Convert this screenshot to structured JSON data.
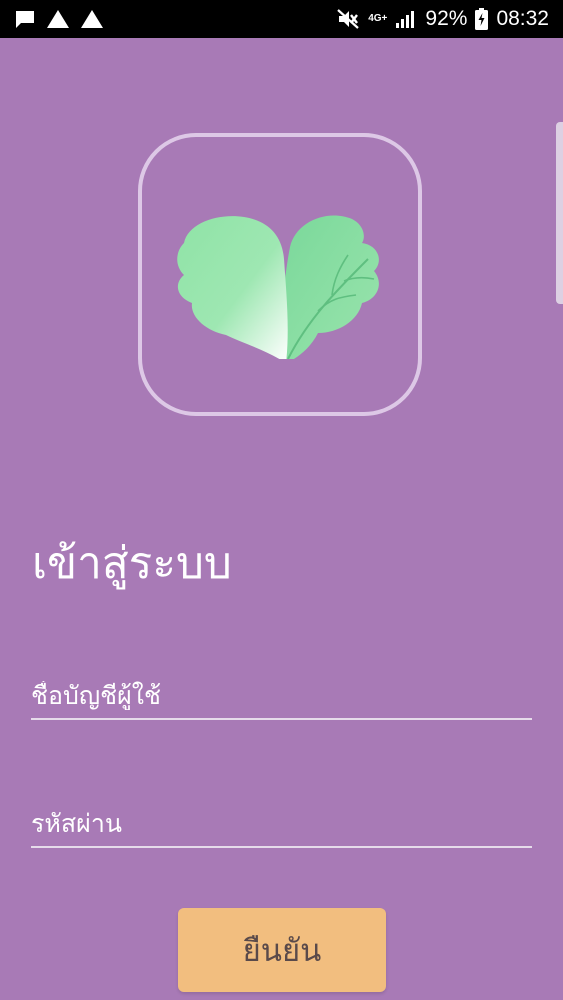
{
  "status_bar": {
    "network_type": "4G+",
    "battery_percent": "92%",
    "time": "08:32",
    "icons": {
      "message": "message-icon",
      "alert1": "warning-triangle-icon",
      "alert2": "warning-triangle-icon",
      "mute": "mute-icon",
      "signal": "signal-strength-icon",
      "battery": "battery-charging-icon"
    }
  },
  "login": {
    "title": "เข้าสู่ระบบ",
    "username_placeholder": "ชื่อบัญชีผู้ใช้",
    "password_placeholder": "รหัสผ่าน",
    "confirm_label": "ยืนยัน"
  },
  "logo": {
    "icon": "leaf-heart-logo-icon"
  },
  "colors": {
    "background": "#a87ab6",
    "logo_border": "#ddc8e6",
    "leaf_green": "#8fe3a6",
    "button": "#f2be7f",
    "button_text": "#5a4a4a"
  }
}
